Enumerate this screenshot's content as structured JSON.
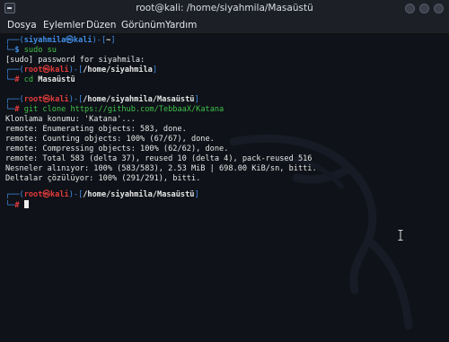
{
  "window": {
    "title": "root@kali: /home/siyahmila/Masaüstü"
  },
  "menu": [
    "Dosya",
    "Eylemler",
    "Düzen",
    "Görünüm",
    "Yardım"
  ],
  "prompt": {
    "open": "┌──(",
    "close": ")-[",
    "end": "]",
    "cmd_prefix": "└─",
    "user_symbol": "$",
    "root_symbol": "#",
    "at": "㉿",
    "host": "kali",
    "user": "siyahmila",
    "root": "root",
    "home": "~",
    "dir_home": "/home/siyahmila",
    "dir_desktop": "/home/siyahmila/Masaüstü"
  },
  "commands": {
    "sudo": "sudo su",
    "cd": "cd Masaüstü",
    "git": "git clone https://github.com/TebbaaX/Katana"
  },
  "output": {
    "sudo_password": "[sudo] password for siyahmila:",
    "clone_1": "Klonlama konumu: 'Katana'...",
    "clone_2": "remote: Enumerating objects: 583, done.",
    "clone_3": "remote: Counting objects: 100% (67/67), done.",
    "clone_4": "remote: Compressing objects: 100% (62/62), done.",
    "clone_5": "remote: Total 583 (delta 37), reused 10 (delta 4), pack-reused 516",
    "clone_6": "Nesneler alınıyor: 100% (583/583), 2.53 MiB | 698.00 KiB/sn, bitti.",
    "clone_7": "Deltalar çözülüyor: 100% (291/291), bitti."
  },
  "colors": {
    "prompt_frame": "#3f8eea",
    "root_user": "#e23b3b",
    "command": "#3fc04a",
    "text": "#e6e6e6",
    "background": "#0f1218"
  },
  "icons": {
    "app": "terminal-icon",
    "minimize": "minimize-icon",
    "maximize": "maximize-icon",
    "close": "close-icon",
    "background": "kali-dragon-logo",
    "mouse": "text-cursor-icon"
  }
}
